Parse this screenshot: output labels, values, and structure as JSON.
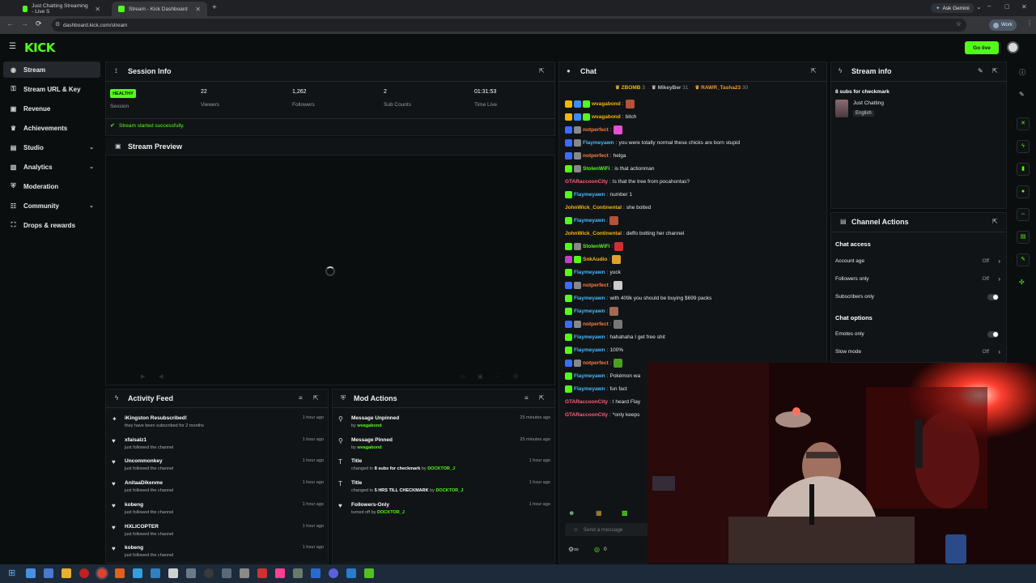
{
  "browser": {
    "tabs": [
      {
        "title": "Just Chatting Streaming - Live S",
        "active": false
      },
      {
        "title": "Stream - Kick Dashboard",
        "active": true
      }
    ],
    "url": "dashboard.kick.com/stream",
    "ask_gemini": "Ask Gemini",
    "profile": "Work"
  },
  "header": {
    "logo": "KICK",
    "go_live": "Go live"
  },
  "sidebar": {
    "items": [
      {
        "label": "Stream",
        "active": true,
        "chevron": false
      },
      {
        "label": "Stream URL & Key",
        "chevron": false
      },
      {
        "label": "Revenue",
        "chevron": false
      },
      {
        "label": "Achievements",
        "chevron": false
      },
      {
        "label": "Studio",
        "chevron": true
      },
      {
        "label": "Analytics",
        "chevron": true
      },
      {
        "label": "Moderation",
        "chevron": false
      },
      {
        "label": "Community",
        "chevron": true
      },
      {
        "label": "Drops & rewards",
        "chevron": false
      }
    ]
  },
  "session": {
    "title": "Session Info",
    "health": "HEALTHY",
    "health_label": "Session",
    "stats": [
      {
        "value": "22",
        "label": "Viewers"
      },
      {
        "value": "1,262",
        "label": "Followers"
      },
      {
        "value": "2",
        "label": "Sub Counts"
      },
      {
        "value": "01:31:53",
        "label": "Time Live"
      }
    ],
    "notice": "Stream started successfully."
  },
  "preview": {
    "title": "Stream Preview"
  },
  "activity": {
    "title": "Activity Feed",
    "items": [
      {
        "title": "iKingston Resubscribed!",
        "sub": "they have been subscribed for 2 months",
        "time": "1 hour ago",
        "icon": "star"
      },
      {
        "title": "xfaisalz1",
        "sub": "just followed the channel",
        "time": "1 hour ago",
        "icon": "heart"
      },
      {
        "title": "Uncommonkey",
        "sub": "just followed the channel",
        "time": "1 hour ago",
        "icon": "heart"
      },
      {
        "title": "AnitaaDikenme",
        "sub": "just followed the channel",
        "time": "1 hour ago",
        "icon": "heart"
      },
      {
        "title": "kobeng",
        "sub": "just followed the channel",
        "time": "1 hour ago",
        "icon": "heart"
      },
      {
        "title": "HXLICOPTER",
        "sub": "just followed the channel",
        "time": "1 hour ago",
        "icon": "heart"
      },
      {
        "title": "kobeng",
        "sub": "just followed the channel",
        "time": "1 hour ago",
        "icon": "heart"
      }
    ]
  },
  "mod": {
    "title": "Mod Actions",
    "items": [
      {
        "title": "Message Unpinned",
        "pre": "by",
        "who": "wvagabond",
        "mid": "",
        "time": "25 minutes ago",
        "icon": "unpin"
      },
      {
        "title": "Message Pinned",
        "pre": "by",
        "who": "wvagabond",
        "mid": "",
        "time": "25 minutes ago",
        "icon": "pin"
      },
      {
        "title": "Title",
        "pre": "changed to",
        "mid": "8 subs for checkmark",
        "who": "DOCKTOR_J",
        "time": "1 hour ago",
        "icon": "title"
      },
      {
        "title": "Title",
        "pre": "changed to",
        "mid": "5 HRS TILL CHECKMARK",
        "who": "DOCKTOR_J",
        "time": "1 hour ago",
        "icon": "title"
      },
      {
        "title": "Followers-Only",
        "pre": "turned off by",
        "mid": "",
        "who": "DOCKTOR_J",
        "time": "1 hour ago",
        "icon": "heart"
      }
    ]
  },
  "chat": {
    "title": "Chat",
    "top_gifters": [
      {
        "name": "ZBOMB",
        "count": "3",
        "color": "#f5b50b"
      },
      {
        "name": "MikeyBer",
        "count": "31",
        "color": "#bbbbbb"
      },
      {
        "name": "RAWR_Tasha23",
        "count": "30",
        "color": "#f59a2b"
      }
    ],
    "messages": [
      {
        "user": "wvagabond",
        "color": "#f5b50b",
        "msg": "",
        "emote": "#b5523a",
        "badges": [
          "#f5b50b",
          "#3a8cff",
          "#53fc18"
        ]
      },
      {
        "user": "wvagabond",
        "color": "#f5b50b",
        "msg": "bitch",
        "badges": [
          "#f5b50b",
          "#3a8cff",
          "#53fc18"
        ]
      },
      {
        "user": "notperfect",
        "color": "#ff7a3d",
        "msg": "",
        "emote": "#e84fd4",
        "badges": [
          "#3a6cff",
          "#888888"
        ]
      },
      {
        "user": "Flaymeyawn",
        "color": "#47b8ff",
        "msg": "you were totally normal these chicks are born stupid",
        "badges": [
          "#3a6cff",
          "#888888"
        ]
      },
      {
        "user": "notperfect",
        "color": "#ff7a3d",
        "msg": "helga",
        "badges": [
          "#3a6cff",
          "#888888"
        ]
      },
      {
        "user": "StolenWiFi",
        "color": "#53fc18",
        "msg": "is that actionman",
        "badges": [
          "#53fc18",
          "#888888"
        ]
      },
      {
        "user": "GTARaccoonCity",
        "color": "#ff5c7a",
        "msg": "Is that the tree from pocahontas?",
        "badges": []
      },
      {
        "user": "Flaymeyawn",
        "color": "#47b8ff",
        "msg": "number 1",
        "badges": [
          "#53fc18"
        ]
      },
      {
        "user": "JohnWick_Continental",
        "color": "#f5b50b",
        "msg": "she botted",
        "badges": []
      },
      {
        "user": "Flaymeyawn",
        "color": "#47b8ff",
        "msg": "",
        "emote": "#b5523a",
        "badges": [
          "#53fc18"
        ]
      },
      {
        "user": "JohnWick_Continental",
        "color": "#f5b50b",
        "msg": "deffo botting her channel",
        "badges": []
      },
      {
        "user": "StolenWiFi",
        "color": "#53fc18",
        "msg": "",
        "emote": "#d03030",
        "badges": [
          "#53fc18",
          "#888888"
        ]
      },
      {
        "user": "SnkAudio",
        "color": "#f5b50b",
        "msg": "",
        "emote": "#e0a030",
        "badges": [
          "#c040c0",
          "#53fc18"
        ]
      },
      {
        "user": "Flaymeyawn",
        "color": "#47b8ff",
        "msg": "yuck",
        "badges": [
          "#53fc18"
        ]
      },
      {
        "user": "notperfect",
        "color": "#ff7a3d",
        "msg": "",
        "emote": "#cccccc",
        "badges": [
          "#3a6cff",
          "#888888"
        ]
      },
      {
        "user": "Flaymeyawn",
        "color": "#47b8ff",
        "msg": "with 409k you should be buying $699 packs",
        "badges": [
          "#53fc18"
        ]
      },
      {
        "user": "Flaymeyawn",
        "color": "#47b8ff",
        "msg": "",
        "emote": "#a06a50",
        "badges": [
          "#53fc18"
        ]
      },
      {
        "user": "notperfect",
        "color": "#ff7a3d",
        "msg": "",
        "emote": "#777777",
        "badges": [
          "#3a6cff",
          "#888888"
        ]
      },
      {
        "user": "Flaymeyawn",
        "color": "#47b8ff",
        "msg": "hahahaha I get free shit",
        "badges": [
          "#53fc18"
        ]
      },
      {
        "user": "Flaymeyawn",
        "color": "#47b8ff",
        "msg": "100%",
        "badges": [
          "#53fc18"
        ]
      },
      {
        "user": "notperfect",
        "color": "#ff7a3d",
        "msg": "",
        "emote": "#4aa020",
        "badges": [
          "#3a6cff",
          "#888888"
        ]
      },
      {
        "user": "Flaymeyawn",
        "color": "#47b8ff",
        "msg": "Pokémon wa",
        "badges": [
          "#53fc18"
        ]
      },
      {
        "user": "Flaymeyawn",
        "color": "#47b8ff",
        "msg": "fun fact",
        "badges": [
          "#53fc18"
        ]
      },
      {
        "user": "GTARaccoonCity",
        "color": "#ff5c7a",
        "msg": "I heard Flay",
        "badges": []
      },
      {
        "user": "GTARaccoonCity",
        "color": "#ff5c7a",
        "msg": "*only keeps",
        "badges": []
      }
    ],
    "input_placeholder": "Send a message",
    "points": "0"
  },
  "stream_info": {
    "title": "Stream info",
    "stream_title": "8 subs for checkmark",
    "category": "Just Chatting",
    "language": "English"
  },
  "channel_actions": {
    "title": "Channel Actions",
    "chat_access": "Chat access",
    "access_rows": [
      {
        "label": "Account age",
        "value": "Off",
        "kind": "chevron"
      },
      {
        "label": "Followers only",
        "value": "Off",
        "kind": "chevron"
      },
      {
        "label": "Subscribers only",
        "value": "",
        "kind": "toggle"
      }
    ],
    "chat_options": "Chat options",
    "option_rows": [
      {
        "label": "Emotes only",
        "value": "",
        "kind": "toggle"
      },
      {
        "label": "Slow mode",
        "value": "Off",
        "kind": "chevron"
      }
    ]
  }
}
